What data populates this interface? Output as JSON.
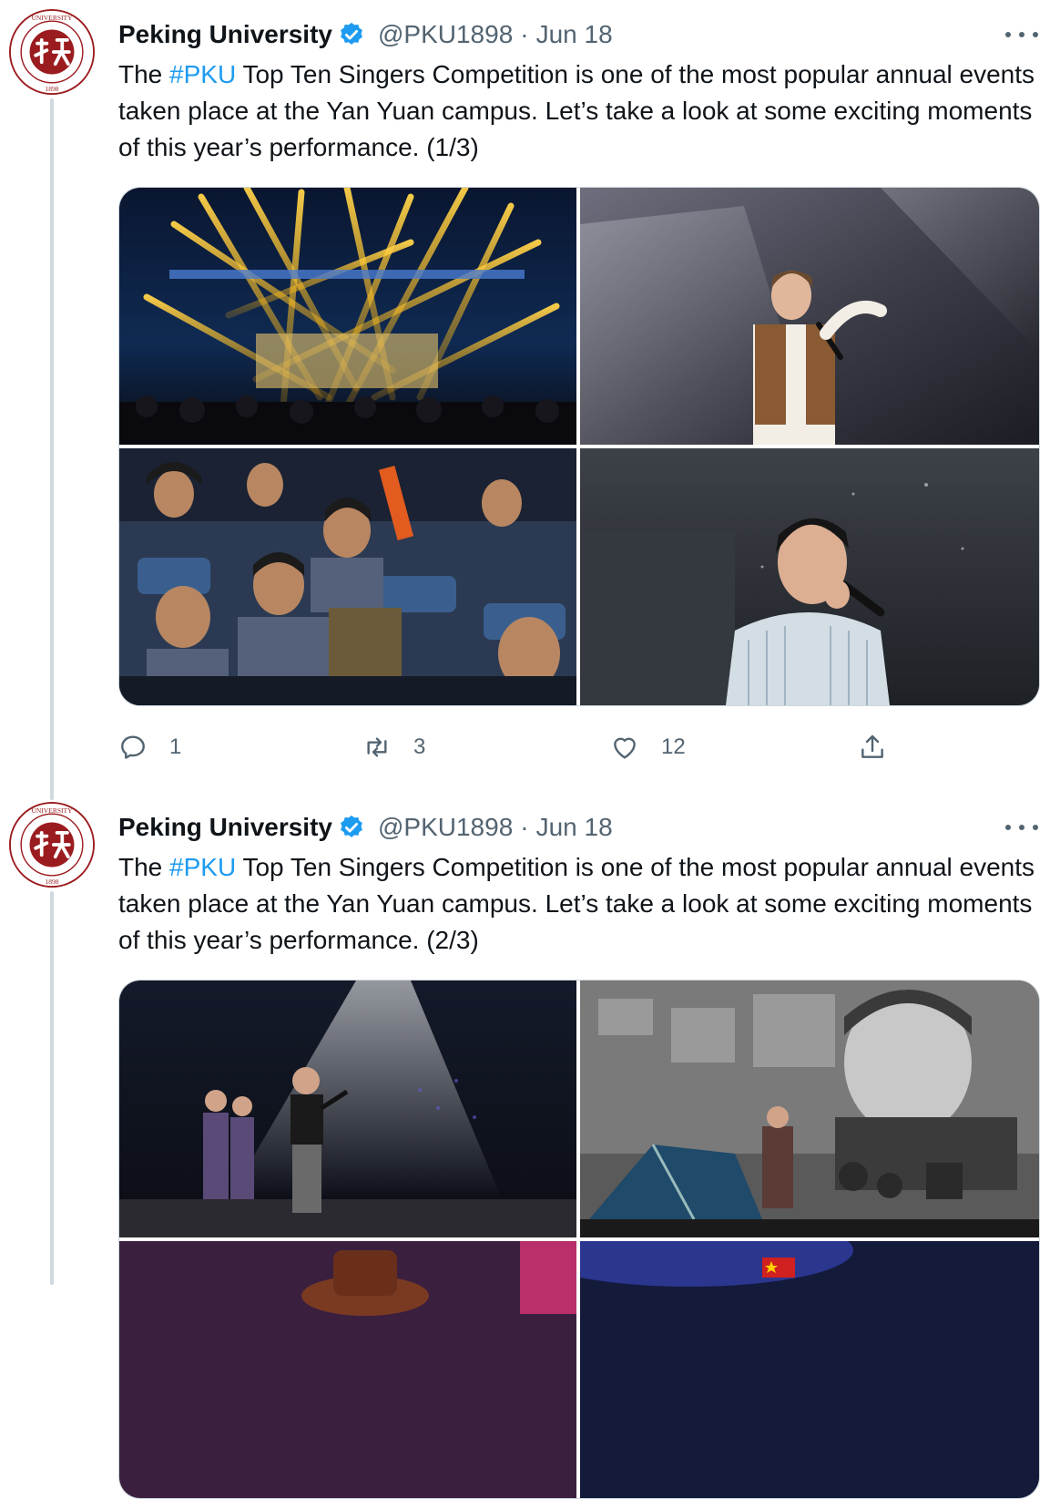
{
  "tweets": [
    {
      "author": "Peking University",
      "handle": "@PKU1898",
      "separator": "·",
      "date": "Jun 18",
      "text_before": "The ",
      "hashtag": "#PKU",
      "text_after": " Top Ten Singers Competition is one of the most popular annual events taken place at the Yan Yuan campus. Let’s take a look at some exciting moments of this year’s performance.   (1/3)",
      "actions": {
        "replies": "1",
        "retweets": "3",
        "likes": "12"
      },
      "photos": [
        {
          "icon": "stage-lights-photo"
        },
        {
          "icon": "female-singer-photo"
        },
        {
          "icon": "audience-photo"
        },
        {
          "icon": "male-singer-photo"
        }
      ]
    },
    {
      "author": "Peking University",
      "handle": "@PKU1898",
      "separator": "·",
      "date": "Jun 18",
      "text_before": "The ",
      "hashtag": "#PKU",
      "text_after": " Top Ten Singers Competition is one of the most popular annual events taken place at the Yan Yuan campus. Let’s take a look at some exciting moments of this year’s performance. (2/3)",
      "photos": [
        {
          "icon": "singer-with-backup-photo"
        },
        {
          "icon": "singer-on-tent-stage-photo"
        },
        {
          "icon": "performer-hat-photo"
        },
        {
          "icon": "stage-flag-photo"
        }
      ]
    }
  ],
  "colors": {
    "accent": "#1d9bf0",
    "logo_red": "#9b1c1f",
    "muted": "#536471"
  }
}
